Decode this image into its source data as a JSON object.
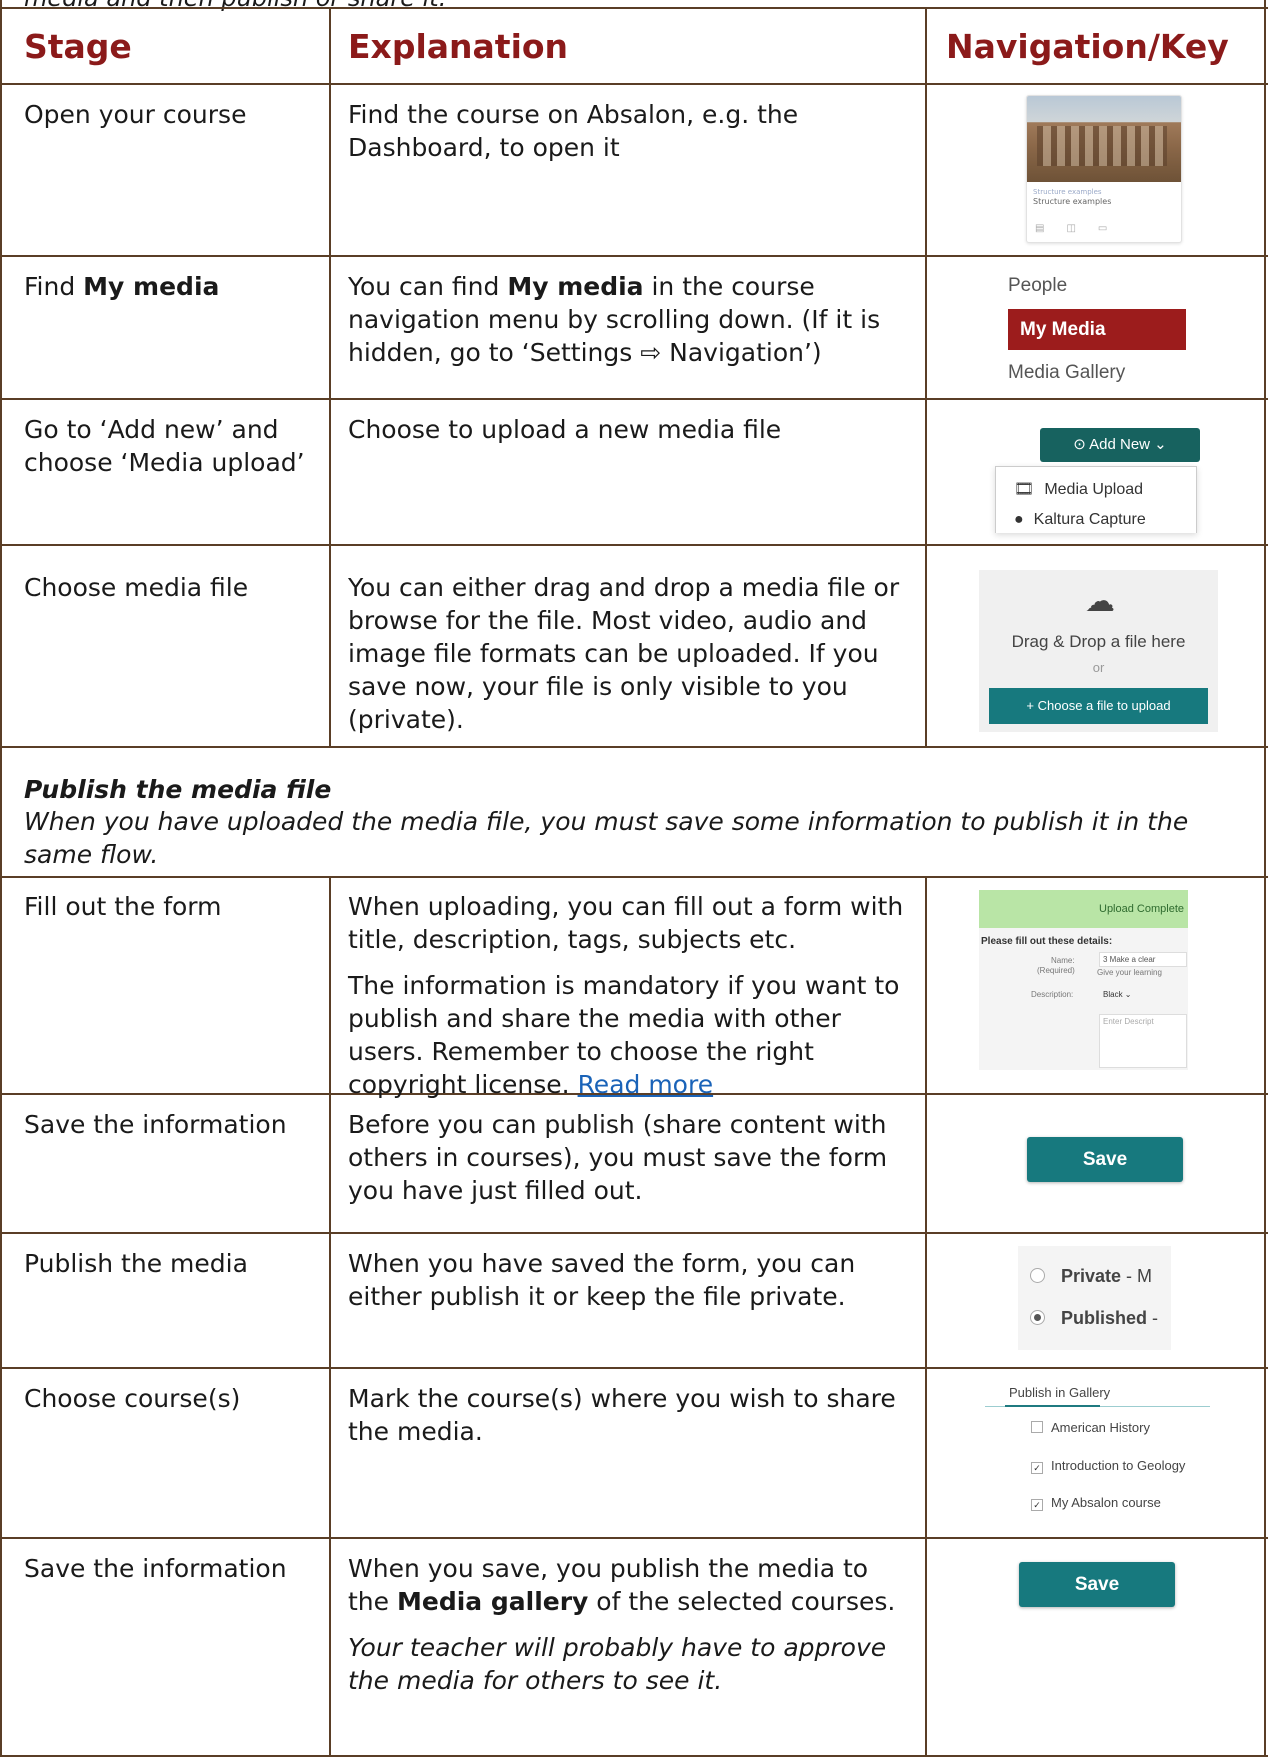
{
  "intro_cut": "media and then publish or share it.",
  "headers": {
    "stage": "Stage",
    "explanation": "Explanation",
    "navigation": "Navigation/Key"
  },
  "rows": [
    {
      "stage": "Open your course",
      "explanation": "Find the course on Absalon, e.g. the Dashboard, to open it"
    },
    {
      "stage_pre": "Find ",
      "stage_bold": "My media",
      "exp_pre": "You can find ",
      "exp_bold": "My media",
      "exp_post": " in the course navigation menu by scrolling down. (If it is hidden, go to ‘Settings ⇨ Navigation’)"
    },
    {
      "stage": "Go to ‘Add new’ and choose ‘Media upload’",
      "explanation": "Choose to upload a new media file"
    },
    {
      "stage": "Choose media file",
      "explanation": "You can either drag and drop a media file or browse for the file. Most video, audio and image file formats can be uploaded. If you save now, your file is only visible to you (private)."
    }
  ],
  "section": {
    "title": "Publish the media file",
    "description": "When you have uploaded the media file, you must save some information to publish it in the same flow."
  },
  "rows2": [
    {
      "stage": "Fill out the form",
      "explanation1": "When uploading, you can fill out a form with title, description, tags, subjects etc.",
      "explanation2": "The information is mandatory if you want to publish and share the media with other users. Remember to choose the right copyright license. ",
      "link": "Read more"
    },
    {
      "stage": "Save the information",
      "explanation": "Before you can publish (share content with others in courses), you must save the form you have just filled out."
    },
    {
      "stage": "Publish the media",
      "explanation": "When you have saved the form, you can either publish it or keep the file private."
    },
    {
      "stage": "Choose course(s)",
      "explanation": "Mark the course(s) where you wish to share the media."
    },
    {
      "stage": "Save the information",
      "exp_pre": "When you save, you publish the media to the ",
      "exp_bold": "Media gallery",
      "exp_post": " of the selected courses.",
      "note": "Your teacher will probably have to approve the media for others to see it."
    }
  ],
  "thumbs": {
    "course_card": {
      "title": "Structure examples",
      "subtitle": "Structure examples"
    },
    "nav": {
      "people": "People",
      "my_media": "My Media",
      "gallery": "Media Gallery"
    },
    "add_new": {
      "button": "⊙ Add New  ⌄",
      "item1": "Media Upload",
      "item2": "Kaltura Capture"
    },
    "upload": {
      "drag": "Drag & Drop a file here",
      "or": "or",
      "choose": "+ Choose a file to upload"
    },
    "form": {
      "complete": "Upload Complete",
      "please": "Please fill out these details:",
      "name_label": "Name:",
      "required": "(Required)",
      "name_value": "3 Make a clear",
      "name_hint": "Give your learning",
      "desc_label": "Description:",
      "desc_value": "Black  ⌄",
      "enter": "Enter Descript"
    },
    "save": "Save",
    "radios": {
      "private_b": "Private",
      "private_rest": " - M",
      "published_b": "Published",
      "published_rest": " -"
    },
    "gallery": {
      "title": "Publish in Gallery",
      "c1": "American History",
      "c2": "Introduction to Geology",
      "c3": "My Absalon course"
    }
  }
}
